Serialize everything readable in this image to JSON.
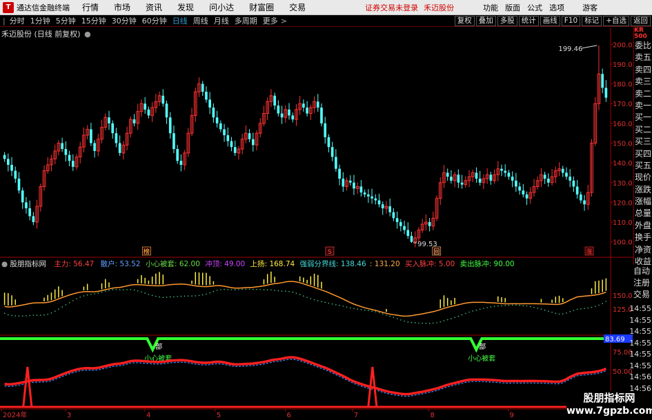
{
  "menubar": {
    "app_name": "通达信金融终端",
    "items": [
      "行情",
      "市场",
      "资讯",
      "发现",
      "问小达",
      "财富圈",
      "交易"
    ],
    "status": "证券交易未登录",
    "stock": "禾迈股份",
    "right_items": [
      "功能",
      "版面",
      "公式",
      "选项"
    ],
    "guest": "游客"
  },
  "toolbar": {
    "periods": [
      "分时",
      "1分钟",
      "5分钟",
      "15分钟",
      "30分钟",
      "60分钟",
      "日线",
      "周线",
      "月线",
      "多周期",
      "更多"
    ],
    "active_period": "日线",
    "right_buttons": [
      "复权",
      "叠加",
      "多股",
      "统计",
      "画线",
      "F10",
      "标记",
      "+自选",
      "返回"
    ]
  },
  "chart": {
    "stock_title": "禾迈股份 (日线 前复权)",
    "high_label": "199.46",
    "low_label": "99.53",
    "markers": [
      "榜",
      "S",
      "回",
      "涨"
    ],
    "colors": {
      "up": "#ff3232",
      "down": "#54ffff",
      "bg": "#000000",
      "grid": "#8b0000"
    }
  },
  "chart_data": [
    {
      "type": "candlestick",
      "title": "禾迈股份 (日线 前复权)",
      "ylim": [
        95,
        205
      ],
      "yticks": [
        100,
        110,
        120,
        130,
        140,
        150,
        160,
        170,
        180,
        190,
        200
      ],
      "xticks": [
        "2024年",
        "3",
        "4",
        "5",
        "6",
        "7",
        "8",
        "9"
      ],
      "high": 199.46,
      "low": 99.53,
      "close": [
        142,
        139,
        136,
        132,
        126,
        120,
        117,
        113,
        110,
        118,
        128,
        136,
        139,
        142,
        146,
        150,
        147,
        144,
        141,
        138,
        143,
        148,
        154,
        157,
        150,
        146,
        152,
        158,
        163,
        160,
        155,
        150,
        145,
        149,
        155,
        162,
        160,
        166,
        170,
        167,
        164,
        168,
        171,
        174,
        170,
        163,
        155,
        147,
        141,
        139,
        145,
        155,
        164,
        176,
        180,
        176,
        172,
        168,
        163,
        160,
        157,
        154,
        151,
        148,
        145,
        147,
        152,
        155,
        152,
        149,
        155,
        160,
        165,
        171,
        174,
        169,
        165,
        163,
        167,
        164,
        162,
        167,
        170,
        168,
        165,
        168,
        171,
        168,
        160,
        153,
        148,
        143,
        137,
        132,
        128,
        131,
        130,
        127,
        128,
        125,
        124,
        123,
        122,
        121,
        119,
        117,
        118,
        115,
        112,
        110,
        108,
        106,
        103,
        100,
        102,
        106,
        109,
        110,
        108,
        112,
        122,
        130,
        135,
        133,
        131,
        134,
        130,
        129,
        131,
        133,
        135,
        132,
        130,
        132,
        134,
        131,
        134,
        137,
        136,
        135,
        133,
        131,
        128,
        126,
        124,
        122,
        125,
        128,
        131,
        134,
        132,
        130,
        133,
        136,
        137,
        135,
        133,
        131,
        128,
        124,
        121,
        119,
        125,
        150,
        170,
        185,
        178,
        173
      ]
    },
    {
      "type": "line",
      "title": "股朋指标网",
      "series": [
        {
          "name": "主力",
          "value": "56.47"
        },
        {
          "name": "散户",
          "value": "53.52"
        },
        {
          "name": "小心被套",
          "value": "62.00"
        },
        {
          "name": "冲顶",
          "value": "49.00"
        },
        {
          "name": "上扬",
          "value": "168.74"
        },
        {
          "name": "强弱分界线",
          "value": "138.46"
        },
        {
          "name": "",
          "value": "131.20"
        },
        {
          "name": "买入脉冲",
          "value": "5.00"
        },
        {
          "name": "卖出脉冲",
          "value": "90.00"
        }
      ],
      "yticks": [
        125.0,
        150.0,
        75.0,
        50.0
      ],
      "highlight_value": "83.69",
      "annotations": [
        "部",
        "小心被套"
      ]
    }
  ],
  "right_panel": {
    "header": "KR 500",
    "items": [
      "委比",
      "卖五",
      "卖四",
      "卖三",
      "卖二",
      "卖一",
      "买一",
      "买二",
      "买三",
      "买四",
      "买五",
      "现价",
      "涨跌",
      "涨幅",
      "总量",
      "外盘",
      "换手",
      "净资",
      "收益"
    ],
    "lower_items": [
      "自动",
      "注册",
      "交易"
    ],
    "times": [
      "14:55",
      "14:55",
      "14:55",
      "14:55",
      "14:55",
      "14:55",
      "14:56",
      "14:56",
      "14:56",
      "14:56"
    ]
  },
  "watermark": {
    "title": "股朋指标网",
    "url": "www.7gpzb.com"
  }
}
